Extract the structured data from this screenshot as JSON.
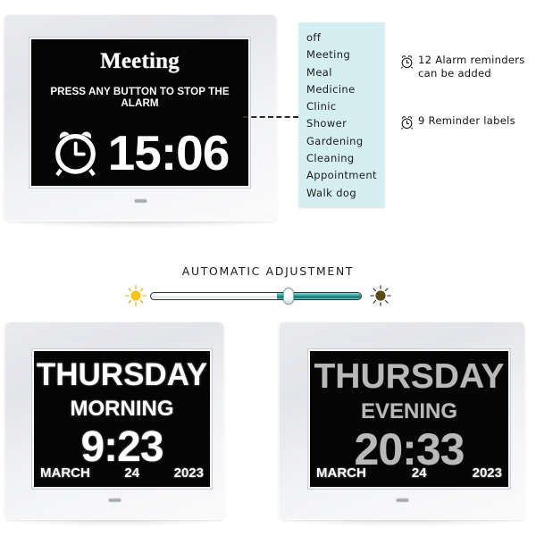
{
  "top_device": {
    "screen": {
      "title": "Meeting",
      "subtitle": "PRESS ANY BUTTON TO STOP THE ALARM",
      "time": "15:06",
      "alarm_icon": "alarm-clock-icon"
    }
  },
  "labels_panel": {
    "items": [
      "off",
      "Meeting",
      "Meal",
      "Medicine",
      "Clinic",
      "Shower",
      "Gardening",
      "Cleaning",
      "Appointment",
      "Walk dog"
    ],
    "background_color": "#d5eef1"
  },
  "notes": [
    {
      "icon": "alarm-clock-icon",
      "text": "12 Alarm reminders can be added"
    },
    {
      "icon": "alarm-clock-icon",
      "text": "9 Reminder labels"
    }
  ],
  "auto_adjust": {
    "title": "AUTOMATIC ADJUSTMENT",
    "left_icon": "bright-sun-icon",
    "right_icon": "dim-sun-icon",
    "fill_color": "#2f9a99",
    "left_icon_color": "#f5c518",
    "right_icon_color": "#5a4a16"
  },
  "clocks": [
    {
      "day": "THURSDAY",
      "period": "MORNING",
      "time": "9:23",
      "month": "MARCH",
      "date": "24",
      "year": "2023",
      "brightness": "bright"
    },
    {
      "day": "THURSDAY",
      "period": "EVENING",
      "time": "20:33",
      "month": "MARCH",
      "date": "24",
      "year": "2023",
      "brightness": "dim"
    }
  ]
}
